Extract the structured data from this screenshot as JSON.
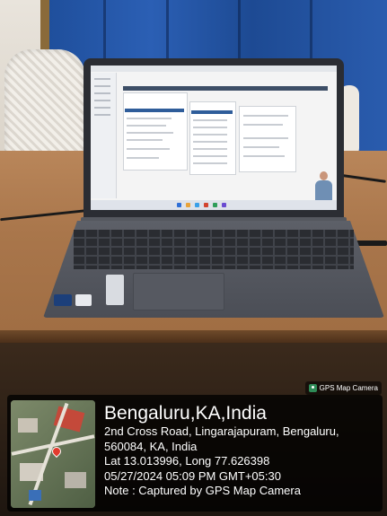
{
  "badge": {
    "label": "GPS Map Camera",
    "icon": "map-pin-icon"
  },
  "geotag": {
    "title": "Bengaluru,KA,India",
    "address_line_1": "2nd Cross Road, Lingarajapuram, Bengaluru,",
    "address_line_2": "560084, KA, India",
    "coordinates": "Lat 13.013996, Long 77.626398",
    "timestamp": "05/27/2024 05:09 PM GMT+05:30",
    "note": "Note : Captured by GPS Map Camera"
  },
  "colors": {
    "curtain": "#2b5fb4",
    "desk": "#a9764b",
    "overlay": "#000000",
    "map_pin": "#e23b2e",
    "badge_icon": "#2e8b57"
  }
}
